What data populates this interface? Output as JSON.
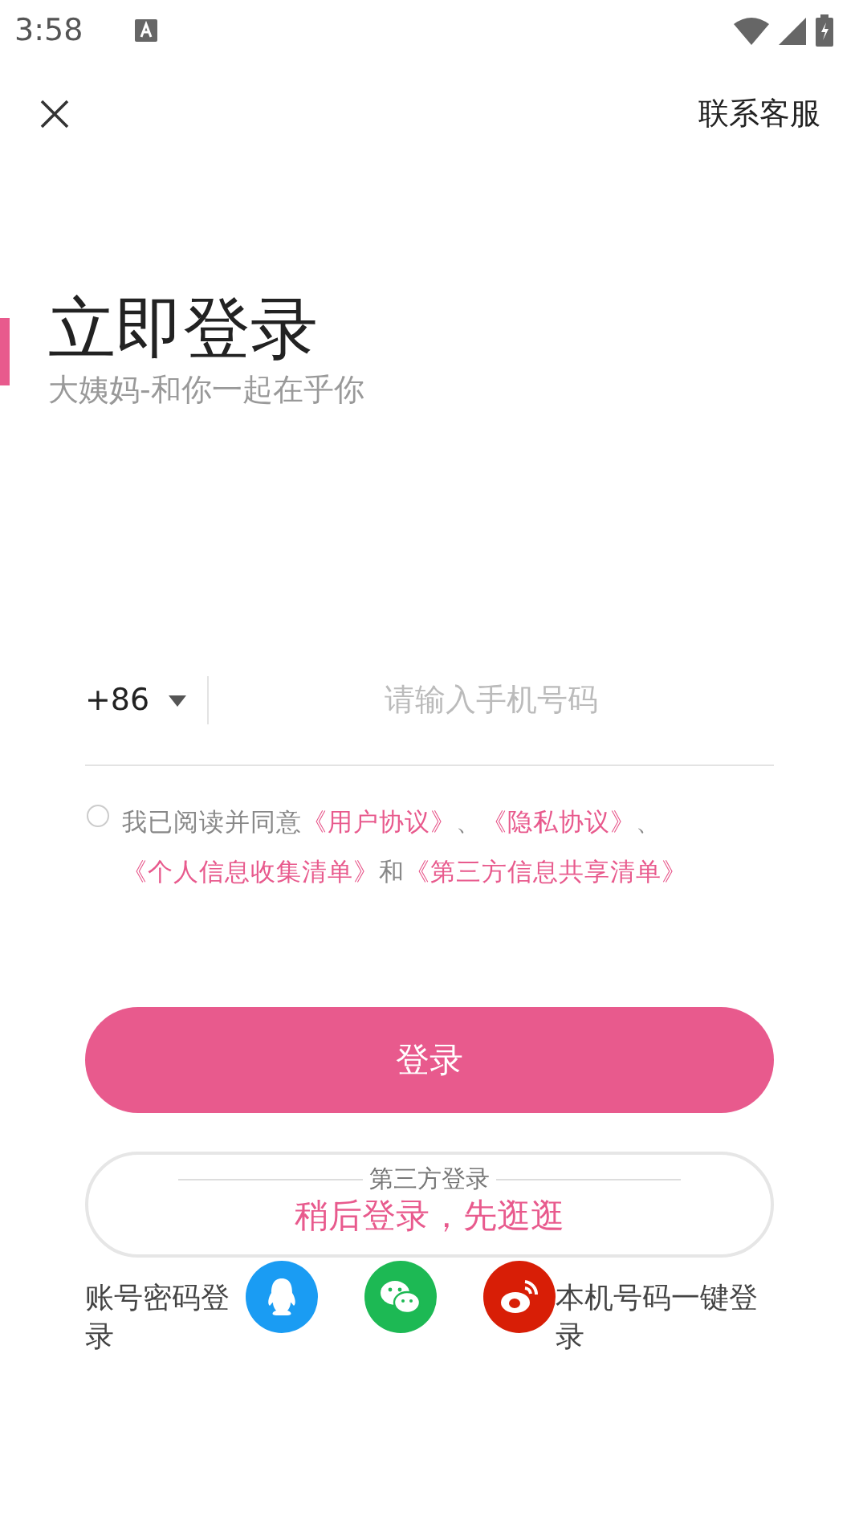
{
  "status_bar": {
    "time": "3:58"
  },
  "top_bar": {
    "contact": "联系客服"
  },
  "title": "立即登录",
  "subtitle": "大姨妈-和你一起在乎你",
  "phone": {
    "country_code": "+86",
    "placeholder": "请输入手机号码"
  },
  "agreement": {
    "checked": false,
    "parts": [
      {
        "kind": "plain",
        "text": "我已阅读并同意"
      },
      {
        "kind": "link",
        "text": "《用户协议》"
      },
      {
        "kind": "plain",
        "text": "、"
      },
      {
        "kind": "link",
        "text": "《隐私协议》"
      },
      {
        "kind": "plain",
        "text": "、"
      },
      {
        "kind": "link",
        "text": "《个人信息收集清单》"
      },
      {
        "kind": "plain",
        "text": "和"
      },
      {
        "kind": "link",
        "text": "《第三方信息共享清单》"
      }
    ]
  },
  "login_button": "登录",
  "browse_button": "稍后登录，先逛逛",
  "third_party": {
    "label": "第三方登录",
    "providers": [
      {
        "kind": "qq"
      },
      {
        "kind": "wechat"
      },
      {
        "kind": "weibo"
      }
    ]
  },
  "bottom_links": [
    "账号密码登录",
    "本机号码一键登录"
  ]
}
